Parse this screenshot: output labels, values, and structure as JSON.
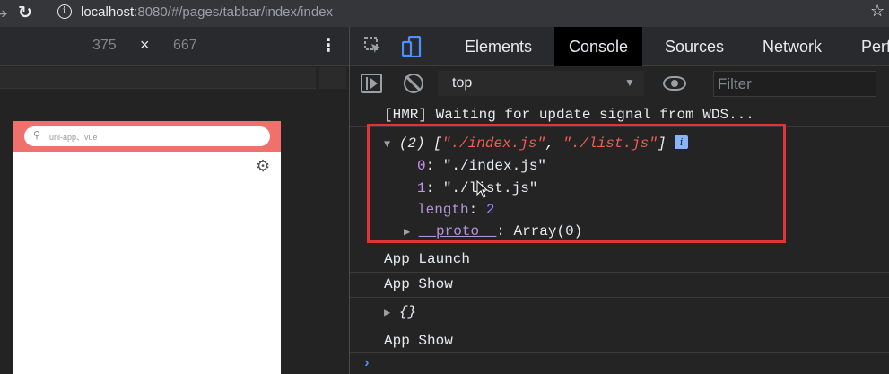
{
  "browser": {
    "url_host": "localhost",
    "url_rest": ":8080/#/pages/tabbar/index/index"
  },
  "device": {
    "width": "375",
    "height": "667",
    "times": "×"
  },
  "phone": {
    "search_placeholder": "uni-app、vue"
  },
  "devtools": {
    "tabs": [
      "Elements",
      "Console",
      "Sources",
      "Network",
      "Perf"
    ],
    "active_tab": "Console"
  },
  "console_toolbar": {
    "context": "top",
    "filter_placeholder": "Filter"
  },
  "console": {
    "hmr": "[HMR] Waiting for update signal from WDS...",
    "array_summary": {
      "count": "(2)",
      "open": "[",
      "item0": "\"./index.js\"",
      "sep": ", ",
      "item1": "\"./list.js\"",
      "close": "]"
    },
    "entries": [
      {
        "key": "0",
        "value": "\"./index.js\""
      },
      {
        "key": "1",
        "value": "\"./list.js\""
      }
    ],
    "length_key": "length",
    "length_value": "2",
    "proto_key": "__proto__",
    "proto_value": "Array(0)",
    "badge": "i",
    "app_launch": "App Launch",
    "app_show_1": "App Show",
    "object": "{}",
    "app_show_2": "App Show",
    "prompt": "›"
  },
  "colors": {
    "highlight_border": "#e03535",
    "phone_header": "#f0706b"
  }
}
